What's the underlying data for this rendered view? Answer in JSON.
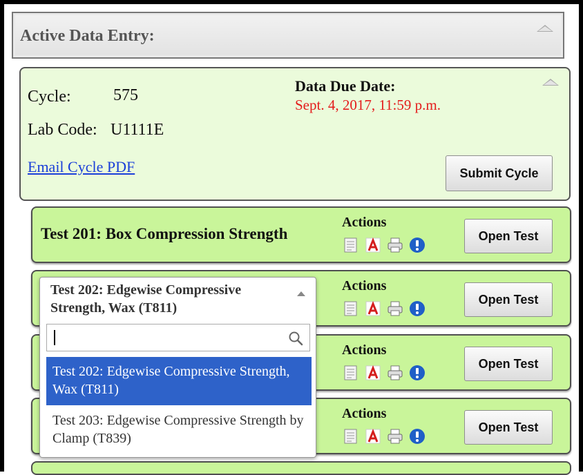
{
  "section": {
    "title": "Active Data Entry:"
  },
  "cycle": {
    "cycle_label": "Cycle:",
    "cycle_value": "575",
    "lab_label": "Lab Code:",
    "lab_value": "U1111E",
    "due_label": "Data Due Date:",
    "due_value": "Sept. 4, 2017, 11:59 p.m.",
    "email_link": "Email Cycle PDF",
    "submit_label": "Submit Cycle"
  },
  "tests": [
    {
      "title": "Test 201: Box Compression Strength",
      "actions_label": "Actions",
      "open_label": "Open Test"
    },
    {
      "title": "",
      "actions_label": "Actions",
      "open_label": "Open Test"
    },
    {
      "title": "",
      "actions_label": "Actions",
      "open_label": "Open Test"
    },
    {
      "title": "",
      "actions_label": "Actions",
      "open_label": "Open Test"
    }
  ],
  "dropdown": {
    "selected": "Test 202: Edgewise Compressive Strength, Wax (T811)",
    "search_value": "",
    "options": [
      {
        "label": "Test 202: Edgewise Compressive Strength, Wax (T811)",
        "highlighted": true
      },
      {
        "label": "Test 203: Edgewise Compressive Strength by Clamp (T839)",
        "highlighted": false
      }
    ]
  },
  "icons": [
    "document-icon",
    "pdf-icon",
    "print-icon",
    "info-icon",
    "search-icon",
    "collapse-icon"
  ],
  "colors": {
    "cycle_bg": "#ebfbdb",
    "test_bg": "#c9f59a",
    "due_date": "#e41b1b",
    "link": "#1a3fd8",
    "selected_option": "#2e62c9"
  }
}
